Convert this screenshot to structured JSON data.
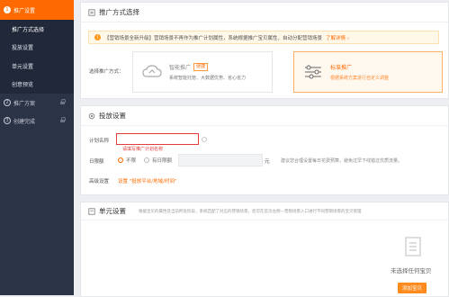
{
  "sidebar": {
    "steps": [
      {
        "num": "1",
        "label": "推广设置",
        "active": true
      },
      {
        "num": "2",
        "label": "推广方案",
        "active": false
      },
      {
        "num": "3",
        "label": "创建完成",
        "active": false
      }
    ],
    "subitems": [
      {
        "label": "推广方式选择"
      },
      {
        "label": "投放设置"
      },
      {
        "label": "单元设置"
      },
      {
        "label": "创意预览"
      }
    ]
  },
  "section1": {
    "title": "推广方式选择",
    "notice_text": "【营销场景全新升级】营销场景不再作为推广计划属性，系统根据推广宝贝属性，自动分配营销场景",
    "notice_link": "了解详情 ›",
    "mode_label": "选择推广方式：",
    "smart": {
      "title": "智能推广",
      "tag": "便捷",
      "desc": "系统智能托管、大数据优势、省心省力"
    },
    "standard": {
      "title": "标准推广",
      "desc": "根据系统方案进行自定义调整"
    }
  },
  "section2": {
    "title": "投放设置",
    "plan_name_label": "计划名称",
    "plan_name_placeholder": "",
    "plan_name_error": "请填写推广计划名称",
    "budget_label": "日限额",
    "budget_none": "不限",
    "budget_daily": "有日限额",
    "budget_unit": "元",
    "budget_hint": "建议您合理设置每日花费预算，避免过早下线错过优质流量。",
    "advanced_label": "高级设置",
    "advanced_link": "设置 \"投放平台/地域/时间\""
  },
  "section3": {
    "title": "单元设置",
    "desc": "根据宝贝的属性及当前所处阶段，系统匹配了对应的营销场景，您可在首页左侧—营销场景入口进行不同营销场景的宝贝管理",
    "empty_text": "未选择任何宝贝",
    "add_button": "添加宝贝"
  },
  "colors": {
    "accent": "#ff6a00",
    "sidebar": "#2b3346",
    "error": "#e43c3c"
  }
}
